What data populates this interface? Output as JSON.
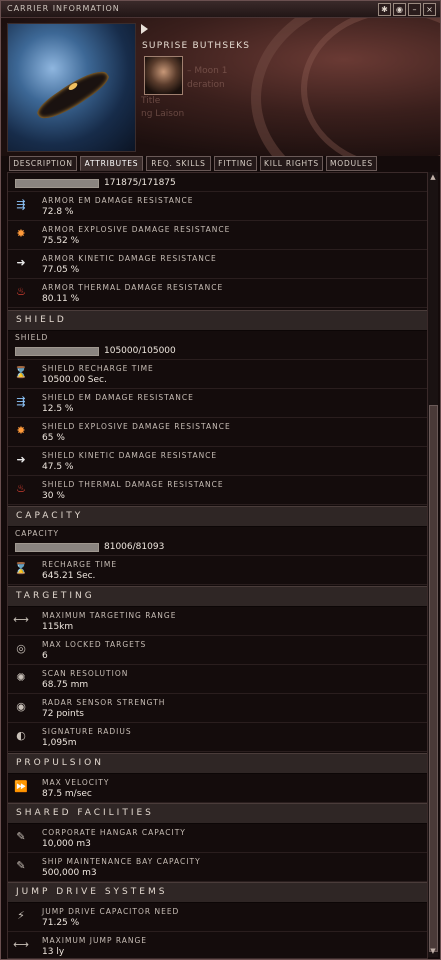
{
  "window": {
    "title": "CARRIER INFORMATION",
    "buttons": [
      "✱",
      "◉",
      "–",
      "×"
    ]
  },
  "header": {
    "pilot_name": "SUPRISE BUTHSEKS",
    "faint_lines": [
      "– Moon 1",
      "deration",
      "Title",
      "ng Laison"
    ]
  },
  "tabs": [
    {
      "label": "DESCRIPTION",
      "active": false
    },
    {
      "label": "ATTRIBUTES",
      "active": true
    },
    {
      "label": "REQ. SKILLS",
      "active": false
    },
    {
      "label": "FITTING",
      "active": false
    },
    {
      "label": "KILL RIGHTS",
      "active": false
    },
    {
      "label": "MODULES",
      "active": false
    }
  ],
  "armor": {
    "hp_value": "171875/171875",
    "hp_fill": 1.0,
    "rows": [
      {
        "label": "ARMOR EM DAMAGE RESISTANCE",
        "value": "72.8 %",
        "icon": "em-resist-icon"
      },
      {
        "label": "ARMOR EXPLOSIVE DAMAGE RESISTANCE",
        "value": "75.52 %",
        "icon": "explosive-resist-icon"
      },
      {
        "label": "ARMOR KINETIC DAMAGE RESISTANCE",
        "value": "77.05 %",
        "icon": "kinetic-resist-icon"
      },
      {
        "label": "ARMOR THERMAL DAMAGE RESISTANCE",
        "value": "80.11 %",
        "icon": "thermal-resist-icon"
      }
    ]
  },
  "shield": {
    "section": "SHIELD",
    "bar_label": "SHIELD",
    "hp_value": "105000/105000",
    "hp_fill": 1.0,
    "rows": [
      {
        "label": "SHIELD RECHARGE TIME",
        "value": "10500.00 Sec.",
        "icon": "hourglass-icon"
      },
      {
        "label": "SHIELD EM DAMAGE RESISTANCE",
        "value": "12.5 %",
        "icon": "em-resist-icon"
      },
      {
        "label": "SHIELD EXPLOSIVE DAMAGE RESISTANCE",
        "value": "65 %",
        "icon": "explosive-resist-icon"
      },
      {
        "label": "SHIELD KINETIC DAMAGE RESISTANCE",
        "value": "47.5 %",
        "icon": "kinetic-resist-icon"
      },
      {
        "label": "SHIELD THERMAL DAMAGE RESISTANCE",
        "value": "30 %",
        "icon": "thermal-resist-icon"
      }
    ]
  },
  "capacity": {
    "section": "CAPACITY",
    "bar_label": "CAPACITY",
    "value": "81006/81093",
    "fill": 0.9989,
    "rows": [
      {
        "label": "RECHARGE TIME",
        "value": "645.21 Sec.",
        "icon": "hourglass-icon"
      }
    ]
  },
  "targeting": {
    "section": "TARGETING",
    "rows": [
      {
        "label": "MAXIMUM TARGETING RANGE",
        "value": "115km",
        "icon": "range-icon"
      },
      {
        "label": "MAX LOCKED TARGETS",
        "value": "6",
        "icon": "target-lock-icon"
      },
      {
        "label": "SCAN RESOLUTION",
        "value": "68.75 mm",
        "icon": "scan-resolution-icon"
      },
      {
        "label": "RADAR SENSOR STRENGTH",
        "value": "72 points",
        "icon": "radar-sensor-icon"
      },
      {
        "label": "SIGNATURE RADIUS",
        "value": "1,095m",
        "icon": "signature-radius-icon"
      }
    ]
  },
  "propulsion": {
    "section": "PROPULSION",
    "rows": [
      {
        "label": "MAX VELOCITY",
        "value": "87.5 m/sec",
        "icon": "velocity-icon"
      }
    ]
  },
  "facilities": {
    "section": "SHARED FACILITIES",
    "rows": [
      {
        "label": "CORPORATE HANGAR CAPACITY",
        "value": "10,000 m3",
        "icon": "wrench-icon"
      },
      {
        "label": "SHIP MAINTENANCE BAY CAPACITY",
        "value": "500,000 m3",
        "icon": "wrench-icon"
      }
    ]
  },
  "jump": {
    "section": "JUMP DRIVE SYSTEMS",
    "rows": [
      {
        "label": "JUMP DRIVE CAPACITOR NEED",
        "value": "71.25 %",
        "icon": "capacitor-icon"
      },
      {
        "label": "MAXIMUM JUMP RANGE",
        "value": "13 ly",
        "icon": "range-icon"
      }
    ]
  }
}
